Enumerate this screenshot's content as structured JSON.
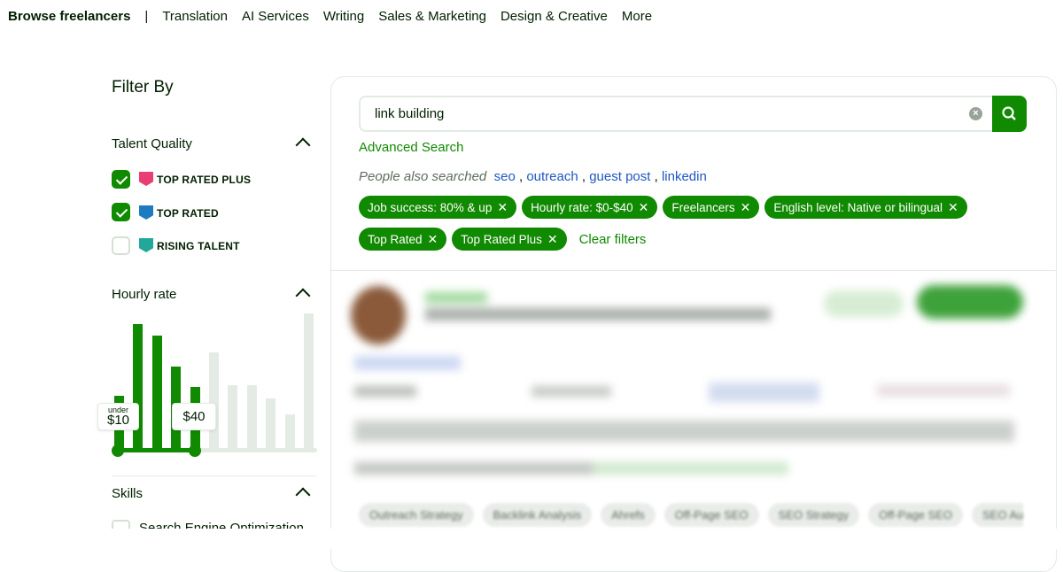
{
  "nav": {
    "title": "Browse freelancers",
    "sep": "|",
    "items": [
      "Translation",
      "AI Services",
      "Writing",
      "Sales & Marketing",
      "Design & Creative",
      "More"
    ]
  },
  "filters": {
    "title": "Filter By",
    "talent_quality": {
      "label": "Talent Quality",
      "options": [
        {
          "label": "TOP RATED PLUS",
          "checked": true,
          "color": "#e83e74"
        },
        {
          "label": "TOP RATED",
          "checked": true,
          "color": "#1f7bc1"
        },
        {
          "label": "RISING TALENT",
          "checked": false,
          "color": "#22a89a"
        }
      ]
    },
    "hourly_rate": {
      "label": "Hourly rate",
      "min_label": "under",
      "min": "$10",
      "max": "$40",
      "histogram": [
        61,
        142,
        129,
        94,
        71,
        110,
        73,
        73,
        58,
        40,
        154
      ],
      "selected_bins": 5
    },
    "skills": {
      "label": "Skills",
      "options": [
        "Search Engine Optimization"
      ]
    }
  },
  "search": {
    "value": "link building",
    "advanced": "Advanced Search",
    "also_label": "People also searched",
    "also": [
      "seo",
      "outreach",
      "guest post",
      "linkedin"
    ],
    "chips": [
      "Job success: 80% & up",
      "Hourly rate: $0-$40",
      "Freelancers",
      "English level: Native or bilingual",
      "Top Rated",
      "Top Rated Plus"
    ],
    "clear": "Clear filters"
  },
  "result": {
    "skills": [
      "Outreach Strategy",
      "Backlink Analysis",
      "Ahrefs",
      "Off-Page SEO",
      "SEO Strategy",
      "Off-Page SEO",
      "SEO Au"
    ]
  },
  "colors": {
    "accent": "#108a00",
    "inactive_bar": "#e4ebe4",
    "link": "#1f57c3"
  }
}
